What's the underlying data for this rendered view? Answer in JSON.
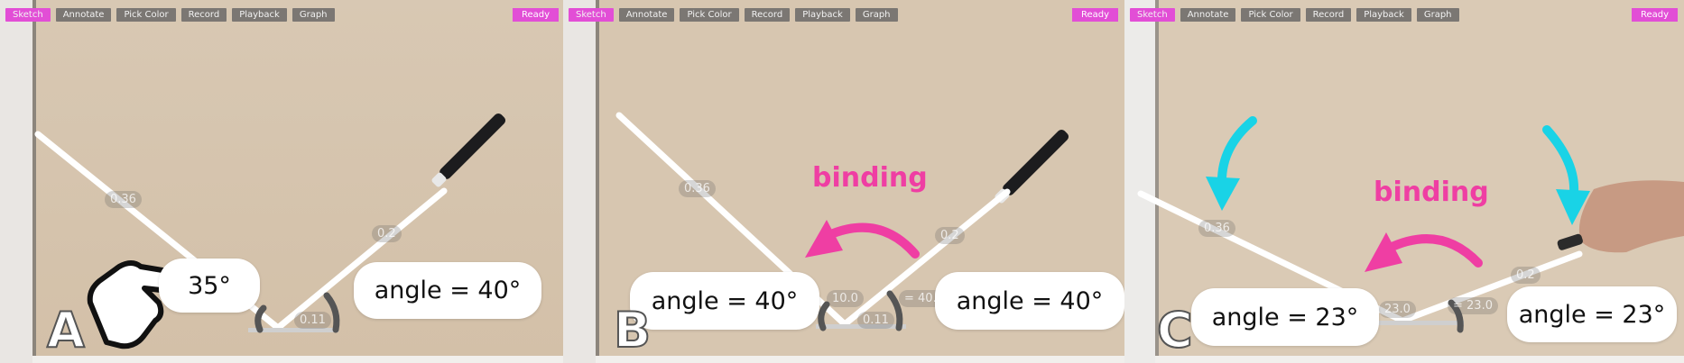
{
  "toolbar": {
    "buttons": [
      "Sketch",
      "Annotate",
      "Pick Color",
      "Record",
      "Playback",
      "Graph"
    ],
    "status": "Ready"
  },
  "panels": [
    {
      "letter": "A",
      "left_bubble": "35°",
      "right_bubble": "angle = 40°",
      "ghost_labels": [
        "0.36",
        "0.2",
        "0.11"
      ]
    },
    {
      "letter": "B",
      "binding": "binding",
      "left_bubble": "angle = 40°",
      "right_bubble": "angle = 40°",
      "ghost_labels": [
        "0.36",
        "0.2",
        "10.0",
        "= 40.0",
        "0.11"
      ]
    },
    {
      "letter": "C",
      "binding": "binding",
      "left_bubble": "angle = 23°",
      "right_bubble": "angle = 23°",
      "ghost_labels": [
        "0.36",
        "0.2",
        "23.0",
        "= 23.0"
      ]
    }
  ],
  "colors": {
    "accent": "#e24ed6",
    "arrow_pink": "#ef3ea3",
    "arrow_cyan": "#19d3e6",
    "toolbar_button": "#7b7773"
  },
  "icons": [
    "pointing-hand-icon",
    "curved-arrow-icon",
    "down-arrow-icon"
  ]
}
